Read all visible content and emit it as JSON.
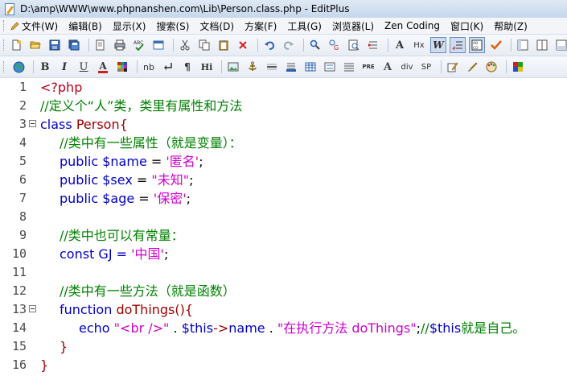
{
  "window": {
    "title": "D:\\amp\\WWW\\www.phpnanshen.com\\Lib\\Person.class.php - EditPlus"
  },
  "menu": [
    {
      "label": "文件(W)",
      "icon": "pencil-icon"
    },
    {
      "label": "编辑(B)"
    },
    {
      "label": "显示(X)"
    },
    {
      "label": "搜索(S)"
    },
    {
      "label": "文档(D)"
    },
    {
      "label": "方案(F)"
    },
    {
      "label": "工具(G)"
    },
    {
      "label": "浏览器(L)"
    },
    {
      "label": "Zen Coding"
    },
    {
      "label": "窗口(K)"
    },
    {
      "label": "帮助(Z)"
    }
  ],
  "toolbar2_text": {
    "bold": "B",
    "italic": "I",
    "underline": "U",
    "font": "A",
    "nbsp": "nb",
    "para": "¶",
    "heading": "Hi",
    "pre": "PRE",
    "font_a": "A",
    "hx": "Hx",
    "div": "div",
    "span": "SP",
    "wrap": "W"
  },
  "colors": {
    "tag": "#b8001c",
    "comment": "#008000",
    "keyword": "#0000c8",
    "string": "#d000d0"
  },
  "code": {
    "lines": [
      {
        "num": "1",
        "fold": false,
        "indent": 0,
        "tokens": [
          {
            "t": "<?php",
            "c": "tag"
          }
        ]
      },
      {
        "num": "2",
        "fold": false,
        "indent": 0,
        "tokens": [
          {
            "t": "//定义个“人”类，类里有属性和方法",
            "c": "cmt"
          }
        ]
      },
      {
        "num": "3",
        "fold": true,
        "indent": 0,
        "tokens": [
          {
            "t": "class",
            "c": "kw"
          },
          {
            "t": " ",
            "c": "op"
          },
          {
            "t": "Person",
            "c": "cls"
          },
          {
            "t": "{",
            "c": "cls"
          }
        ]
      },
      {
        "num": "4",
        "fold": false,
        "indent": 1,
        "tokens": [
          {
            "t": "//类中有一些属性（就是变量）：",
            "c": "cmt"
          }
        ]
      },
      {
        "num": "5",
        "fold": false,
        "indent": 1,
        "tokens": [
          {
            "t": "public",
            "c": "kw"
          },
          {
            "t": " ",
            "c": "op"
          },
          {
            "t": "$name",
            "c": "var"
          },
          {
            "t": " = ",
            "c": "op"
          },
          {
            "t": "'匿名'",
            "c": "str"
          },
          {
            "t": ";",
            "c": "op"
          }
        ]
      },
      {
        "num": "6",
        "fold": false,
        "indent": 1,
        "tokens": [
          {
            "t": "public",
            "c": "kw"
          },
          {
            "t": " ",
            "c": "op"
          },
          {
            "t": "$sex",
            "c": "var"
          },
          {
            "t": " = ",
            "c": "op"
          },
          {
            "t": "\"未知\"",
            "c": "str"
          },
          {
            "t": ";",
            "c": "op"
          }
        ]
      },
      {
        "num": "7",
        "fold": false,
        "indent": 1,
        "tokens": [
          {
            "t": "public",
            "c": "kw"
          },
          {
            "t": " ",
            "c": "op"
          },
          {
            "t": "$age",
            "c": "var"
          },
          {
            "t": " = ",
            "c": "op"
          },
          {
            "t": "'保密'",
            "c": "str"
          },
          {
            "t": ";",
            "c": "op"
          }
        ]
      },
      {
        "num": "8",
        "fold": false,
        "indent": 0,
        "tokens": []
      },
      {
        "num": "9",
        "fold": false,
        "indent": 1,
        "tokens": [
          {
            "t": "//类中也可以有常量：",
            "c": "cmt"
          }
        ]
      },
      {
        "num": "10",
        "fold": false,
        "indent": 1,
        "tokens": [
          {
            "t": "const",
            "c": "kw"
          },
          {
            "t": " GJ = ",
            "c": "kw"
          },
          {
            "t": "'中国'",
            "c": "str"
          },
          {
            "t": ";",
            "c": "op"
          }
        ]
      },
      {
        "num": "11",
        "fold": false,
        "indent": 0,
        "tokens": []
      },
      {
        "num": "12",
        "fold": false,
        "indent": 1,
        "tokens": [
          {
            "t": "//类中有一些方法（就是函数）",
            "c": "cmt"
          }
        ]
      },
      {
        "num": "13",
        "fold": true,
        "indent": 1,
        "tokens": [
          {
            "t": "function",
            "c": "kw"
          },
          {
            "t": " ",
            "c": "op"
          },
          {
            "t": "doThings",
            "c": "fn"
          },
          {
            "t": "(){",
            "c": "fn"
          }
        ]
      },
      {
        "num": "14",
        "fold": false,
        "indent": 2,
        "tokens": [
          {
            "t": "echo",
            "c": "kw"
          },
          {
            "t": " ",
            "c": "op"
          },
          {
            "t": "\"<br />\"",
            "c": "str"
          },
          {
            "t": " . ",
            "c": "op"
          },
          {
            "t": "$this",
            "c": "var"
          },
          {
            "t": "->",
            "c": "fn"
          },
          {
            "t": "name",
            "c": "kw"
          },
          {
            "t": " . ",
            "c": "op"
          },
          {
            "t": "\"在执行方法 doThings\"",
            "c": "str"
          },
          {
            "t": ";",
            "c": "op"
          },
          {
            "t": "//",
            "c": "cmt"
          },
          {
            "t": "$this",
            "c": "var"
          },
          {
            "t": "就是自己。",
            "c": "cmt"
          }
        ]
      },
      {
        "num": "15",
        "fold": false,
        "indent": 1,
        "tokens": [
          {
            "t": "}",
            "c": "fn"
          }
        ]
      },
      {
        "num": "16",
        "fold": false,
        "indent": 0,
        "tokens": [
          {
            "t": "}",
            "c": "cls"
          }
        ]
      }
    ]
  }
}
